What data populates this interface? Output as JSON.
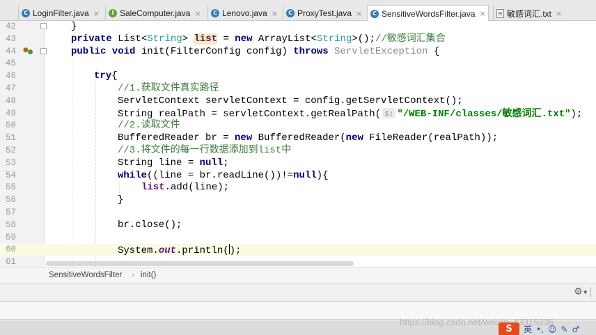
{
  "tabs": [
    {
      "label": "LoginFilter.java",
      "icon": "class-c-icon"
    },
    {
      "label": "SaleComputer.java",
      "icon": "interface-i-icon"
    },
    {
      "label": "Lenovo.java",
      "icon": "class-c-icon"
    },
    {
      "label": "ProxyTest.java",
      "icon": "class-c-icon"
    },
    {
      "label": "SensitiveWordsFilter.java",
      "icon": "class-c-icon",
      "active": true
    },
    {
      "label": "敏感词汇.txt",
      "icon": "text-file-icon"
    }
  ],
  "tab_close": "×",
  "editor": {
    "line_numbers": [
      "42",
      "43",
      "44",
      "45",
      "46",
      "47",
      "48",
      "49",
      "50",
      "51",
      "52",
      "53",
      "54",
      "55",
      "56",
      "57",
      "58",
      "59",
      "60",
      "61"
    ],
    "current_line": "60",
    "param_hint": "s:",
    "code": {
      "l42_brace": "}",
      "l43_a": "private",
      "l43_b": " List<",
      "l43_c": "String",
      "l43_d": "> ",
      "l43_e": "list",
      "l43_f": " = ",
      "l43_g": "new",
      "l43_h": " ArrayList<",
      "l43_i": "String",
      "l43_j": ">();",
      "l43_k": "//敏感词汇集合",
      "l44_a": "public void",
      "l44_b": " init(FilterConfig config) ",
      "l44_c": "throws",
      "l44_d": " ServletException",
      "l44_e": " {",
      "l46_a": "try",
      "l46_b": "{",
      "l47": "//1.获取文件真实路径",
      "l48": "ServletContext servletContext = config.getServletContext();",
      "l49_a": "String realPath = servletContext.getRealPath(",
      "l49_b": "\"/WEB-INF/classes/敏感词汇.txt\"",
      "l49_c": ");",
      "l50": "//2.读取文件",
      "l51_a": "BufferedReader br = ",
      "l51_b": "new",
      "l51_c": " BufferedReader(",
      "l51_d": "new",
      "l51_e": " FileReader(realPath));",
      "l52": "//3.将文件的每一行数据添加到list中",
      "l53_a": "String line = ",
      "l53_b": "null",
      "l53_c": ";",
      "l54_a": "while",
      "l54_b": "((line = br.readLine())!=",
      "l54_c": "null",
      "l54_d": "){",
      "l55_a": "list",
      "l55_b": ".add(line);",
      "l56": "}",
      "l58": "br.close();",
      "l60_a": "System.",
      "l60_b": "out",
      "l60_c": ".println(",
      "l60_d": ")",
      "l60_e": ";"
    }
  },
  "breadcrumb": [
    "SensitiveWordsFilter",
    "init()"
  ],
  "breadcrumb_sep": "›",
  "watermark": "https://blog.csdn.net/weixin_43319236",
  "ime": {
    "logo": "S",
    "lang": "英",
    "punct": "•,",
    "emoji": "☺",
    "pen": "✎",
    "extra": "♂"
  },
  "colors": {
    "keyword": "#000080",
    "string": "#008000",
    "comment": "#808080",
    "field": "#660e7a",
    "current_line": "#fbfae3"
  }
}
